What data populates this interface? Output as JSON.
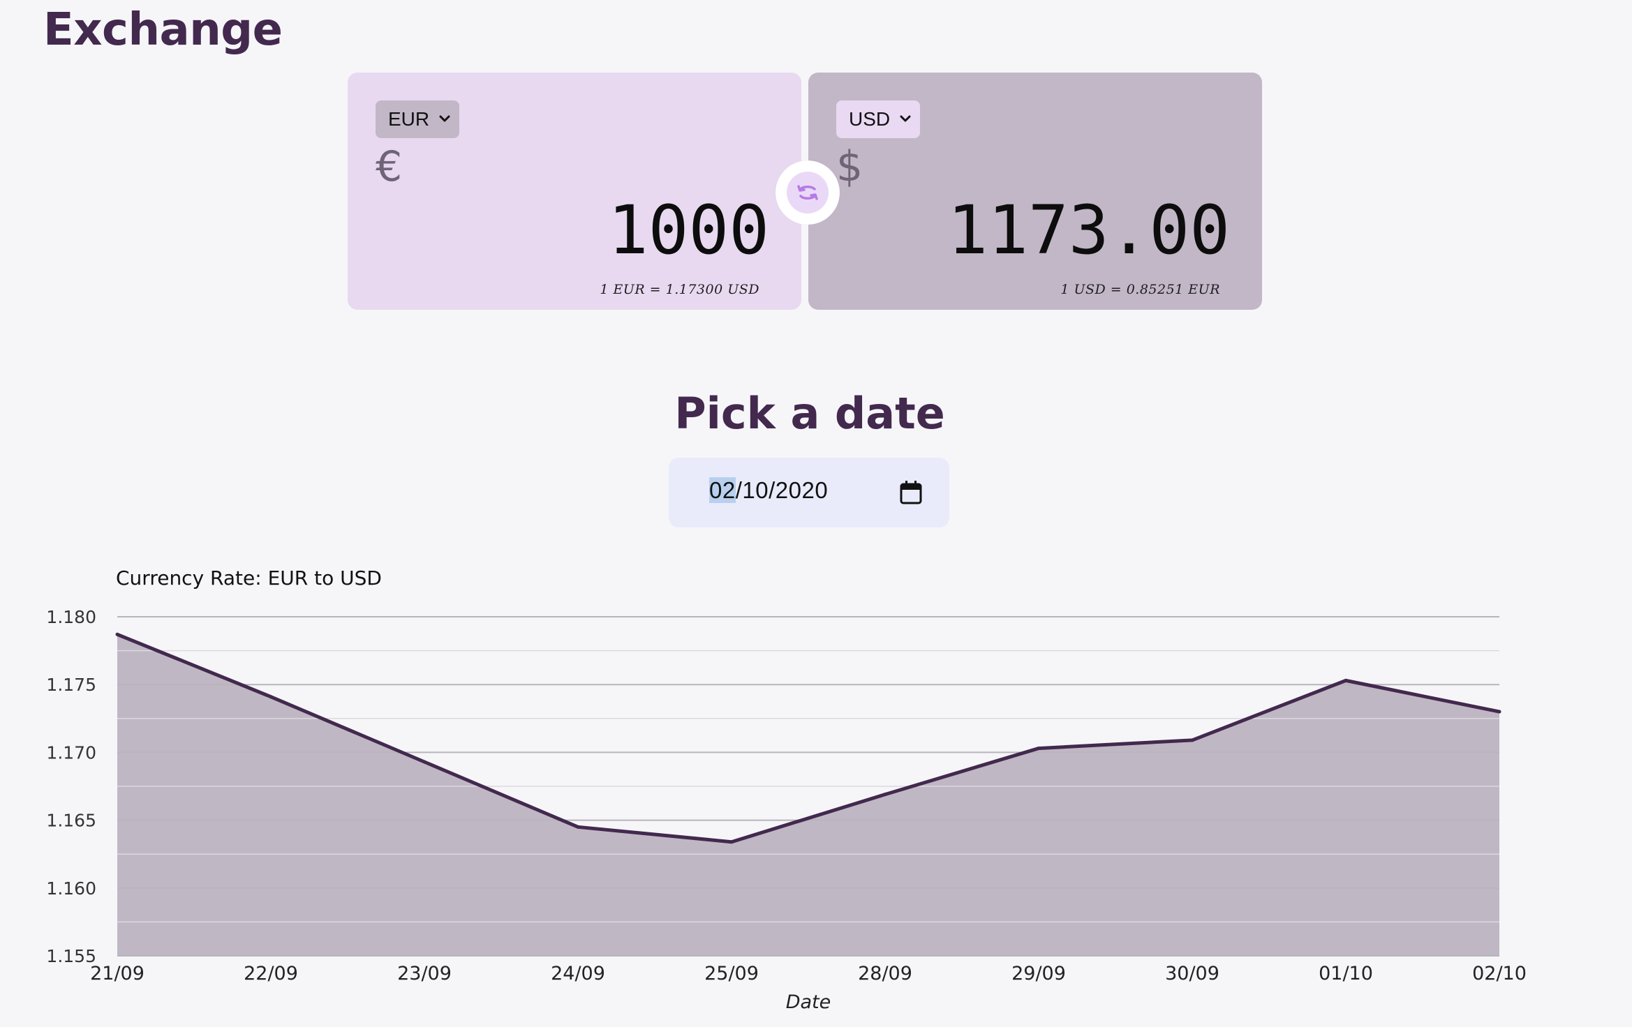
{
  "app": {
    "title": "Exchange"
  },
  "from": {
    "currency": "EUR",
    "symbol": "€",
    "amount": "1000",
    "rate_note": "1 EUR = 1.17300 USD"
  },
  "to": {
    "currency": "USD",
    "symbol": "$",
    "amount": "1173.00",
    "rate_note": "1 USD = 0.85251 EUR"
  },
  "date_picker": {
    "title": "Pick a date",
    "day": "02",
    "rest": "/10/2020"
  },
  "icons": {
    "swap": "swap-arrows-icon",
    "calendar": "calendar-icon",
    "chevron": "chevron-down-icon"
  },
  "colors": {
    "accent": "#43294e",
    "card_from": "#e8d9f1",
    "card_to": "#c2b7c7",
    "chart_fill": "#c0b7c4",
    "chart_line": "#43294e"
  },
  "chart_data": {
    "type": "area",
    "title": "Currency Rate: EUR to USD",
    "xlabel": "Date",
    "ylabel": "",
    "categories": [
      "21/09",
      "22/09",
      "23/09",
      "24/09",
      "25/09",
      "28/09",
      "29/09",
      "30/09",
      "01/10",
      "02/10"
    ],
    "values": [
      1.1787,
      1.1741,
      1.1693,
      1.1645,
      1.1634,
      1.1669,
      1.1703,
      1.1709,
      1.1753,
      1.173
    ],
    "ylim": [
      1.155,
      1.18
    ],
    "yticks": [
      "1.180",
      "1.175",
      "1.170",
      "1.165",
      "1.160",
      "1.155"
    ],
    "grid": true,
    "legend": "none"
  }
}
